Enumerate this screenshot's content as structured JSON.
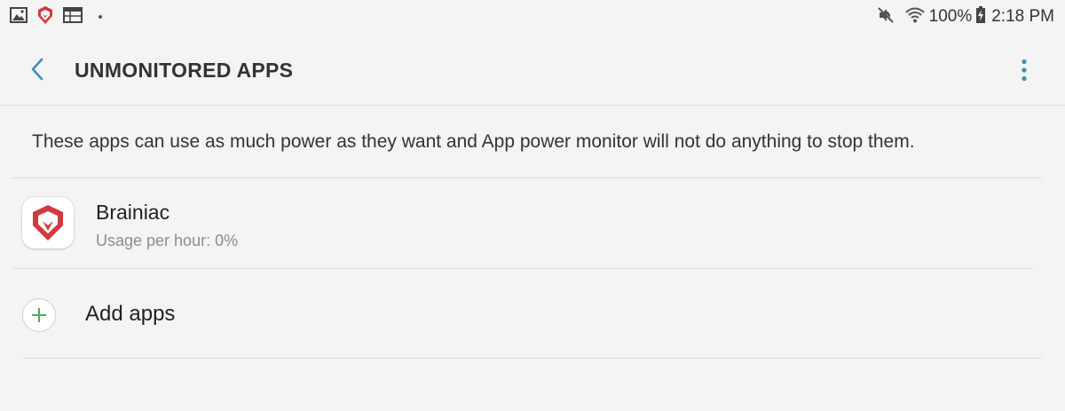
{
  "status_bar": {
    "left_icons": [
      "gallery-icon",
      "brainiac-notification-icon",
      "calendar-icon"
    ],
    "right_icons": [
      "mute-icon",
      "wifi-icon",
      "battery-charging-icon"
    ],
    "battery": "100%",
    "time": "2:18 PM"
  },
  "app_bar": {
    "title": "UNMONITORED APPS",
    "back_icon": "back-arrow-icon",
    "menu_icon": "more-vert-icon",
    "accent_color": "#3e8fb0"
  },
  "description": "These apps can use as much power as they want and App power monitor will not do anything to stop them.",
  "apps": [
    {
      "name": "Brainiac",
      "usage": "Usage per hour: 0%",
      "icon": "brainiac-app-icon",
      "icon_color": "#d0393e"
    }
  ],
  "add_apps": {
    "label": "Add apps",
    "icon": "plus-icon",
    "icon_color": "#4caf50"
  }
}
